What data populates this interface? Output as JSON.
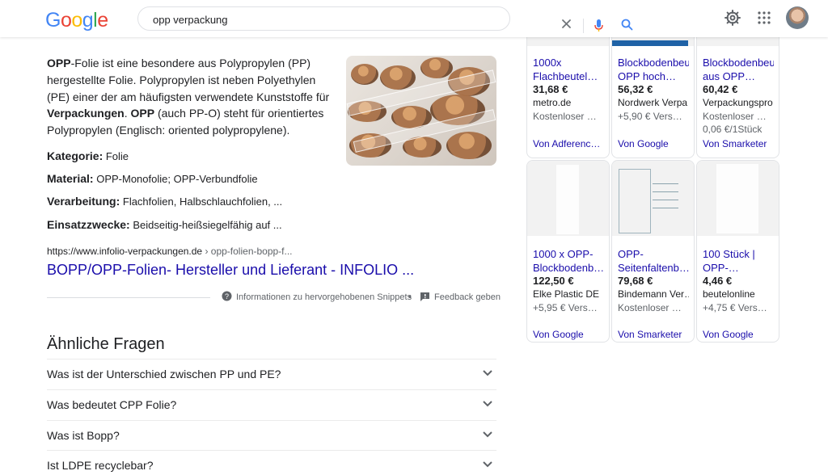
{
  "header": {
    "logo": [
      "G",
      "o",
      "o",
      "g",
      "l",
      "e"
    ],
    "search_query": "opp verpackung",
    "colors": {
      "blue": "#4285f4",
      "red": "#ea4335",
      "yellow": "#fbbc05",
      "green": "#34a853",
      "link": "#1a0dab"
    }
  },
  "featured_snippet": {
    "text_parts": [
      "OPP",
      "-Folie ist eine besondere aus Polypropylen (PP) hergestellte Folie. Polypropylen ist neben Polyethylen (PE) einer der am häufigsten verwendete Kunststoffe für ",
      "Verpackungen",
      ". ",
      "OPP",
      " (auch PP-O) steht für orientiertes Polypropylen (Englisch: oriented polypropylene)."
    ],
    "facts": [
      {
        "label": "Kategorie:",
        "value": "Folie"
      },
      {
        "label": "Material:",
        "value": "OPP-Monofolie; OPP-Verbundfolie"
      },
      {
        "label": "Verarbeitung:",
        "value": "Flachfolien, Halbschlauchfolien, ..."
      },
      {
        "label": "Einsatzzwecke:",
        "value": "Beidseitig-heißsiegelfähig auf ..."
      }
    ],
    "url": "https://www.infolio-verpackungen.de",
    "url_path": "› opp-folien-bopp-f...",
    "title": "BOPP/OPP-Folien- Hersteller und Lieferant - INFOLIO ...",
    "footer": {
      "info": "Informationen zu hervorgehobenen Snippets",
      "separator": "•",
      "feedback": "Feedback geben"
    }
  },
  "similar_questions": {
    "title": "Ähnliche Fragen",
    "questions": [
      "Was ist der Unterschied zwischen PP und PE?",
      "Was bedeutet CPP Folie?",
      "Was ist Bopp?",
      "Ist LDPE recyclebar?"
    ]
  },
  "shopping": {
    "products": [
      {
        "title": "1000x\nFlachbeutel…",
        "price": "31,68 €",
        "seller": "metro.de",
        "shipping": "Kostenloser …",
        "unit_price": "",
        "source": "Von Adferenc…"
      },
      {
        "title": "Blockbodenbeut\nOPP hoch…",
        "price": "56,32 €",
        "seller": "Nordwerk Verpa",
        "shipping": "+5,90 € Vers…",
        "unit_price": "",
        "source": "Von Google"
      },
      {
        "title": "Blockbodenbeut\naus OPP…",
        "price": "60,42 €",
        "seller": "Verpackungspro",
        "shipping": "Kostenloser …",
        "unit_price": "0,06 €/1Stück",
        "source": "Von Smarketer"
      },
      {
        "title": "1000 x OPP-\nBlockbodenb…",
        "price": "122,50 €",
        "seller": "Elke Plastic DE",
        "shipping": "+5,95 € Vers…",
        "unit_price": "",
        "source": "Von Google"
      },
      {
        "title": "OPP-\nSeitenfaltenb…",
        "price": "79,68 €",
        "seller": "Bindemann Ver…",
        "shipping": "Kostenloser …",
        "unit_price": "",
        "source": "Von Smarketer"
      },
      {
        "title": "100 Stück |\nOPP-…",
        "price": "4,46 €",
        "seller": "beutelonline",
        "shipping": "+4,75 € Vers…",
        "unit_price": "",
        "source": "Von Google"
      }
    ]
  }
}
